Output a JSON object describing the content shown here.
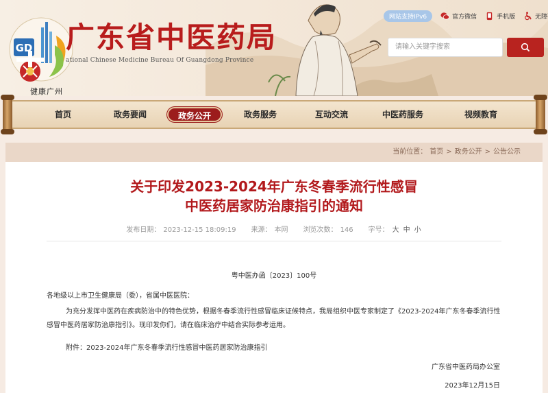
{
  "header": {
    "site_title": "广东省中医药局",
    "site_subtitle": "ational Chinese Medicine Bureau Of Guangdong Province",
    "logo_caption": "健康广州",
    "ipv6_badge": "网站支持IPv6",
    "top_links": {
      "wechat": "官方微信",
      "mobile": "手机版",
      "accessible": "无障碍"
    },
    "search": {
      "placeholder": "请输入关键字搜索"
    }
  },
  "nav": {
    "items": [
      {
        "label": "首页"
      },
      {
        "label": "政务要闻"
      },
      {
        "label": "政务公开",
        "active": true
      },
      {
        "label": "政务服务"
      },
      {
        "label": "互动交流"
      },
      {
        "label": "中医药服务"
      },
      {
        "label": "视频教育"
      }
    ]
  },
  "breadcrumb": {
    "prefix": "当前位置：",
    "items": [
      "首页",
      "政务公开",
      "公告公示"
    ],
    "separator": ">"
  },
  "article": {
    "title_line1": "关于印发2023-2024年广东冬春季流行性感冒",
    "title_line2": "中医药居家防治康指引的通知",
    "meta": {
      "publish_label": "发布日期：",
      "publish_value": "2023-12-15 18:09:19",
      "source_label": "来源：",
      "source_value": "本网",
      "views_label": "浏览次数：",
      "views_value": "146",
      "fontsize_label": "字号：",
      "fontsize_large": "大",
      "fontsize_medium": "中",
      "fontsize_small": "小"
    },
    "doc_number": "粤中医办函〔2023〕100号",
    "salutation": "各地级以上市卫生健康局（委），省属中医医院：",
    "paragraph": "为充分发挥中医药在疾病防治中的特色优势，根据冬春季流行性感冒临床证候特点，我局组织中医专家制定了《2023-2024年广东冬春季流行性感冒中医药居家防治康指引》。现印发你们，请在临床治疗中结合实际参考运用。",
    "attachment": "附件：2023-2024年广东冬春季流行性感冒中医药居家防治康指引",
    "signature_org": "广东省中医药局办公室",
    "signature_date": "2023年12月15日"
  },
  "colors": {
    "brand_red": "#b8231f",
    "title_red": "#b2191c",
    "nav_active": "#9c1c1c",
    "page_bg": "#f6ebe3",
    "crumb_bg": "#ead7c8"
  }
}
